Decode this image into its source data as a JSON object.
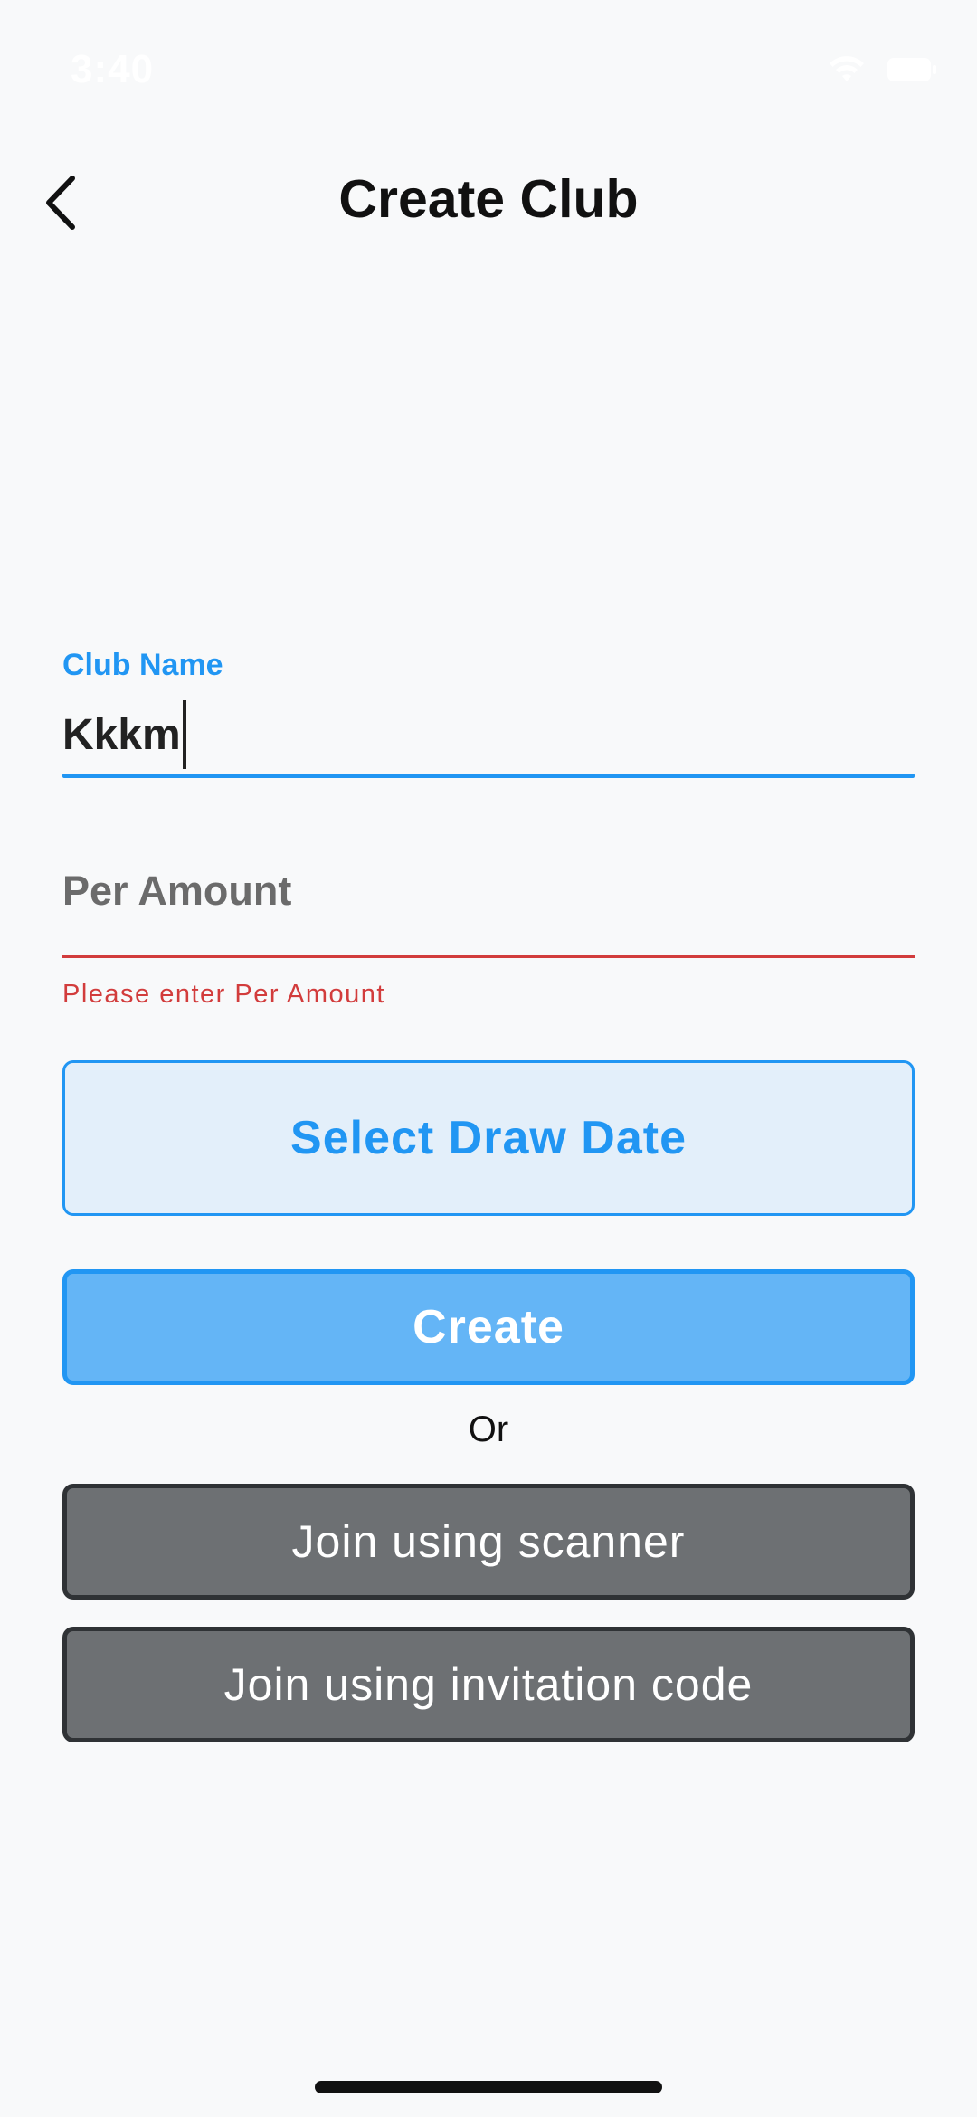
{
  "status_bar": {
    "time": "3:40",
    "icons": [
      "wifi-icon",
      "battery-icon"
    ]
  },
  "header": {
    "back_icon": "chevron-left-icon",
    "title": "Create Club"
  },
  "form": {
    "club_name": {
      "label": "Club Name",
      "value": "Kkkm"
    },
    "per_amount": {
      "placeholder": "Per Amount",
      "error": "Please enter Per Amount"
    }
  },
  "buttons": {
    "select_draw_date": "Select Draw Date",
    "create": "Create",
    "or": "Or",
    "join_scanner": "Join using scanner",
    "join_code": "Join using invitation code"
  },
  "colors": {
    "accent": "#2196f3",
    "error": "#d23c3c",
    "create_fill": "#64b5f6",
    "join_fill": "#6d7073"
  }
}
